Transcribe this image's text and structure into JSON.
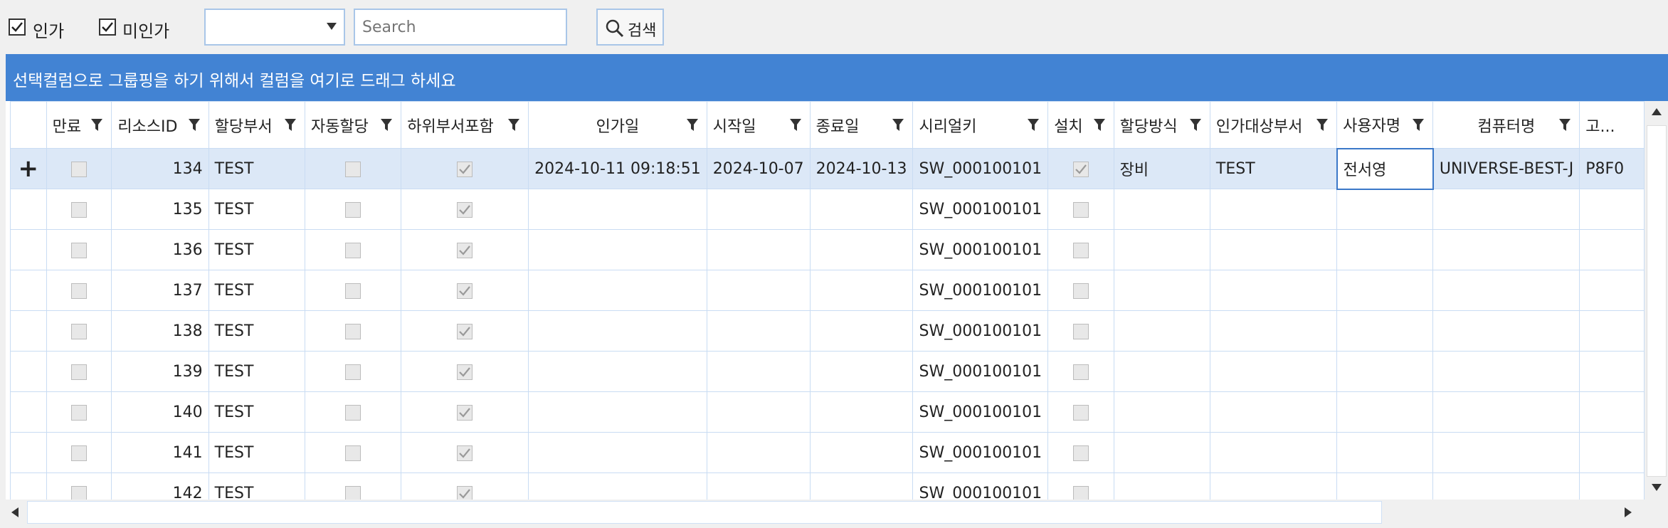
{
  "filters": {
    "approved_label": "인가",
    "unapproved_label": "미인가",
    "approved_checked": true,
    "unapproved_checked": true,
    "combo_value": "",
    "search_placeholder": "Search",
    "search_button_label": "검색"
  },
  "group_panel_text": "선택컬럼으로 그룹핑을 하기 위해서 컬럼을 여기로 드래그 하세요",
  "columns": [
    "만료",
    "리소스ID",
    "할당부서",
    "자동할당",
    "하위부서포함",
    "인가일",
    "시작일",
    "종료일",
    "시리얼키",
    "설치",
    "할당방식",
    "인가대상부서",
    "사용자명",
    "컴퓨터명",
    "고..."
  ],
  "rows": [
    {
      "id": "134",
      "dept": "TEST",
      "approved": "2024-10-11 09:18:51",
      "start": "2024-10-07",
      "end": "2024-10-13",
      "serial": "SW_000100101",
      "method": "장비",
      "target_dept": "TEST",
      "user": "전서영",
      "computer": "UNIVERSE-BEST-J",
      "extra": "P8F0"
    },
    {
      "id": "135",
      "dept": "TEST",
      "approved": "",
      "start": "",
      "end": "",
      "serial": "SW_000100101",
      "method": "",
      "target_dept": "",
      "user": "",
      "computer": "",
      "extra": ""
    },
    {
      "id": "136",
      "dept": "TEST",
      "approved": "",
      "start": "",
      "end": "",
      "serial": "SW_000100101",
      "method": "",
      "target_dept": "",
      "user": "",
      "computer": "",
      "extra": ""
    },
    {
      "id": "137",
      "dept": "TEST",
      "approved": "",
      "start": "",
      "end": "",
      "serial": "SW_000100101",
      "method": "",
      "target_dept": "",
      "user": "",
      "computer": "",
      "extra": ""
    },
    {
      "id": "138",
      "dept": "TEST",
      "approved": "",
      "start": "",
      "end": "",
      "serial": "SW_000100101",
      "method": "",
      "target_dept": "",
      "user": "",
      "computer": "",
      "extra": ""
    },
    {
      "id": "139",
      "dept": "TEST",
      "approved": "",
      "start": "",
      "end": "",
      "serial": "SW_000100101",
      "method": "",
      "target_dept": "",
      "user": "",
      "computer": "",
      "extra": ""
    },
    {
      "id": "140",
      "dept": "TEST",
      "approved": "",
      "start": "",
      "end": "",
      "serial": "SW_000100101",
      "method": "",
      "target_dept": "",
      "user": "",
      "computer": "",
      "extra": ""
    },
    {
      "id": "141",
      "dept": "TEST",
      "approved": "",
      "start": "",
      "end": "",
      "serial": "SW_000100101",
      "method": "",
      "target_dept": "",
      "user": "",
      "computer": "",
      "extra": ""
    },
    {
      "id": "142",
      "dept": "TEST",
      "approved": "",
      "start": "",
      "end": "",
      "serial": "SW_000100101",
      "method": "",
      "target_dept": "",
      "user": "",
      "computer": "",
      "extra": ""
    }
  ],
  "expand_icon": "plus-icon",
  "filter_icon": "funnel-icon"
}
